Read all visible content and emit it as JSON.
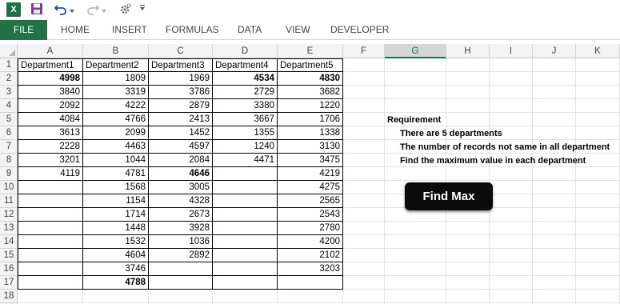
{
  "app": {
    "logo_text": "X",
    "colors": {
      "brand": "#217346",
      "button_bg": "#0b0b0b",
      "button_text": "#ffffff"
    }
  },
  "qat": {
    "icons": [
      "excel-logo-icon",
      "save-icon",
      "undo-icon",
      "undo-dropdown-icon",
      "redo-icon",
      "redo-dropdown-icon",
      "macro-icon",
      "customize-qat-icon"
    ]
  },
  "ribbon": {
    "tabs": [
      "FILE",
      "HOME",
      "INSERT",
      "FORMULAS",
      "DATA",
      "VIEW",
      "DEVELOPER"
    ]
  },
  "grid": {
    "columns": [
      "A",
      "B",
      "C",
      "D",
      "E",
      "F",
      "G",
      "H",
      "I",
      "J",
      "K"
    ],
    "selected_column": "G",
    "rows": [
      "1",
      "2",
      "3",
      "4",
      "5",
      "6",
      "7",
      "8",
      "9",
      "10",
      "11",
      "12",
      "13",
      "14",
      "15",
      "16",
      "17",
      "18"
    ],
    "headers": [
      "Department1",
      "Department2",
      "Department3",
      "Department4",
      "Department5"
    ],
    "data": [
      [
        "4998",
        "1809",
        "1969",
        "4534",
        "4830"
      ],
      [
        "3840",
        "3319",
        "3786",
        "2729",
        "3682"
      ],
      [
        "2092",
        "4222",
        "2879",
        "3380",
        "1220"
      ],
      [
        "4084",
        "4766",
        "2413",
        "3667",
        "1706"
      ],
      [
        "3613",
        "2099",
        "1452",
        "1355",
        "1338"
      ],
      [
        "2228",
        "4463",
        "4597",
        "1240",
        "3130"
      ],
      [
        "3201",
        "1044",
        "2084",
        "4471",
        "3475"
      ],
      [
        "4119",
        "4781",
        "4646",
        "",
        "4219"
      ],
      [
        "",
        "1568",
        "3005",
        "",
        "4275"
      ],
      [
        "",
        "1154",
        "4328",
        "",
        "2565"
      ],
      [
        "",
        "1714",
        "2673",
        "",
        "2543"
      ],
      [
        "",
        "1448",
        "3928",
        "",
        "2780"
      ],
      [
        "",
        "1532",
        "1036",
        "",
        "4200"
      ],
      [
        "",
        "4604",
        "2892",
        "",
        "2102"
      ],
      [
        "",
        "3746",
        "",
        "",
        "3203"
      ],
      [
        "",
        "4788",
        "",
        "",
        ""
      ]
    ],
    "bold_cells": [
      "0-0",
      "0-3",
      "0-4",
      "7-2",
      "15-1"
    ]
  },
  "notes": {
    "title": "Requirement",
    "lines": [
      "There are 5 departments",
      "The number of records not same in all department",
      "Find the maximum value in each department"
    ]
  },
  "find_max_label": "Find Max"
}
